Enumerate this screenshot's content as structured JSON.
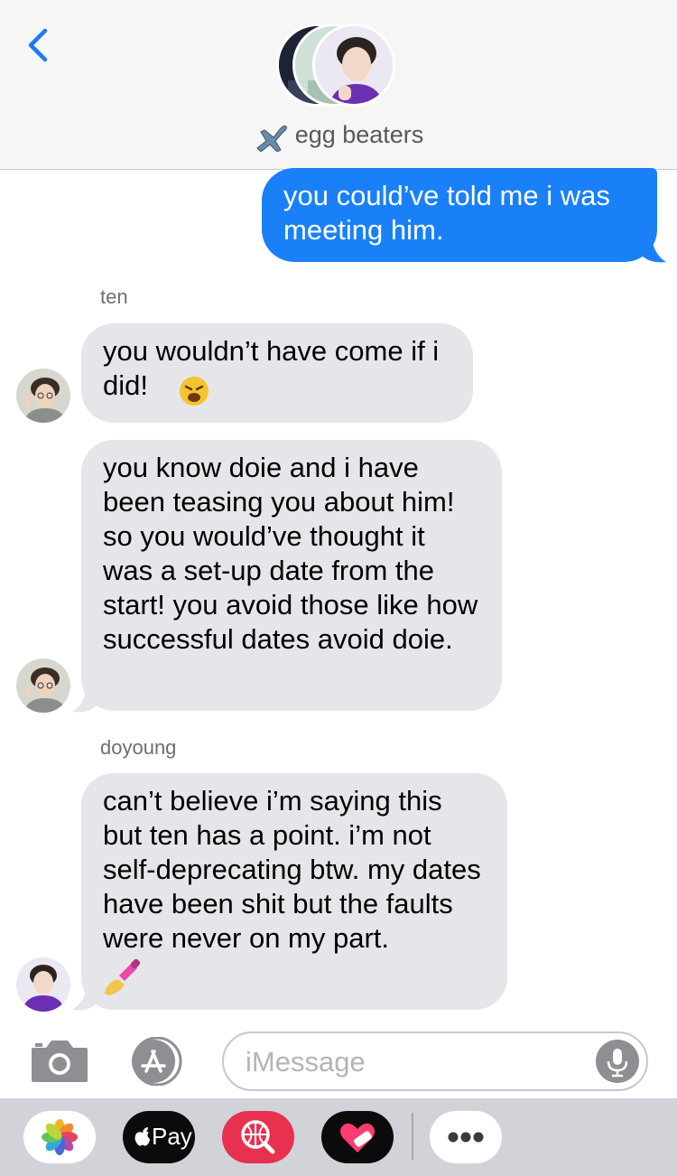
{
  "header": {
    "title": "egg beaters",
    "title_emoji": "airplane-icon",
    "back_icon": "chevron-left-icon"
  },
  "messages": [
    {
      "type": "sent",
      "text": "you could’ve told me i was meeting him."
    },
    {
      "type": "sender",
      "name": "ten"
    },
    {
      "type": "received",
      "text": "you wouldn’t have come if i did!",
      "emoji": "weary-face"
    },
    {
      "type": "received",
      "text": "you know doie and i have been teasing you about him! so you would’ve thought it was a set-up date from the start! you avoid those like how successful dates avoid doie."
    },
    {
      "type": "sender",
      "name": "doyoung"
    },
    {
      "type": "received",
      "text": "can’t believe i’m saying this but ten has a point. i’m not self-deprecating btw. my dates have been shit but the faults were never on my part.",
      "emoji": "nail-polish"
    }
  ],
  "input": {
    "placeholder": "iMessage"
  },
  "app_strip": {
    "apple_pay_label": "Pay",
    "apps": [
      "photos-icon",
      "apple-pay-icon",
      "web-search-icon",
      "heart-stickers-icon",
      "more-icon"
    ]
  },
  "colors": {
    "sent_bubble": "#1a80f8",
    "received_bubble": "#e5e5ea",
    "accent": "#1a7cf5"
  }
}
